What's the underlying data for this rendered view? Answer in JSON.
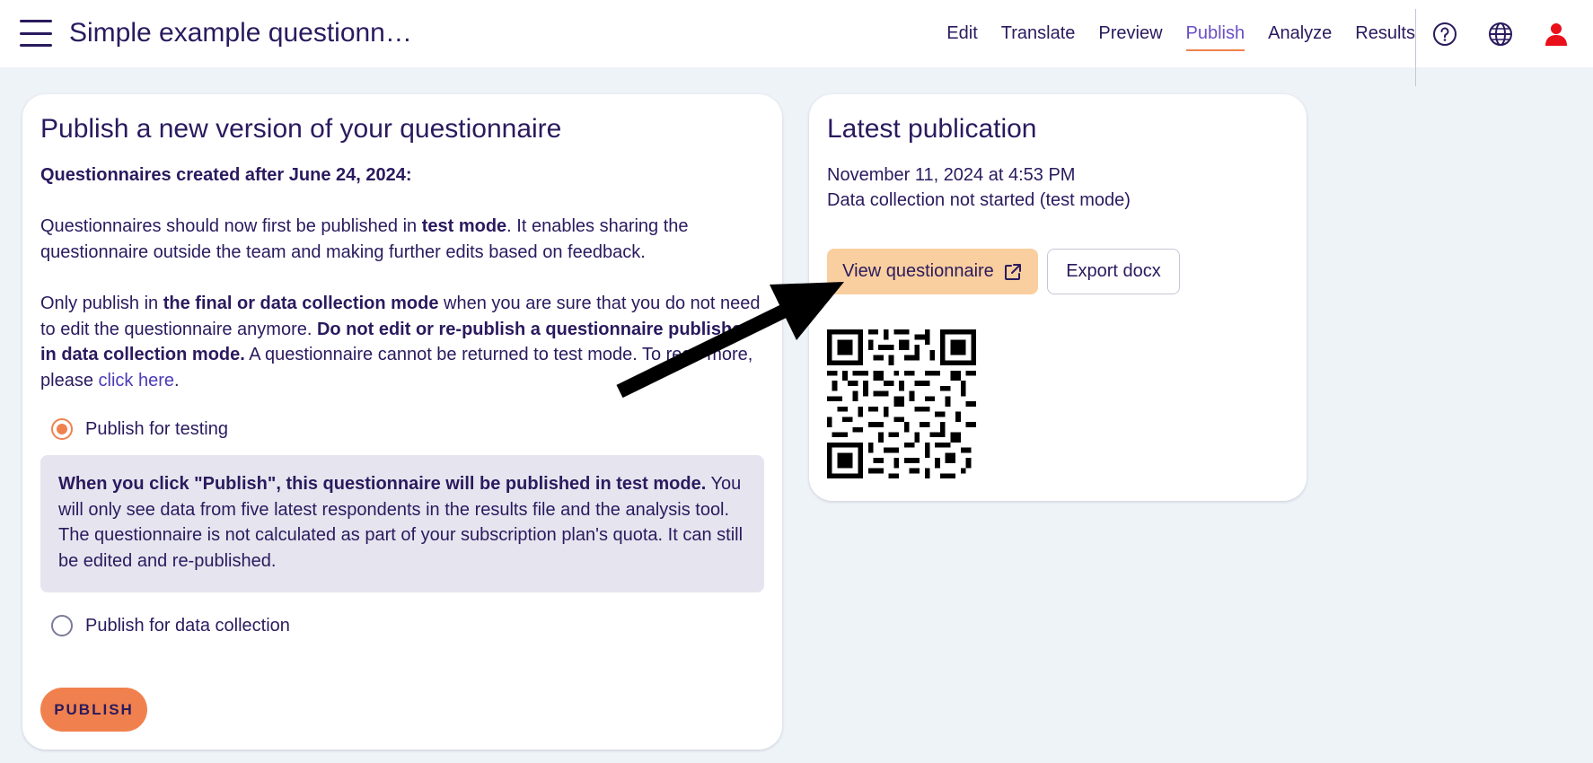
{
  "header": {
    "title": "Simple example questionn…",
    "nav": [
      {
        "label": "Edit"
      },
      {
        "label": "Translate"
      },
      {
        "label": "Preview"
      },
      {
        "label": "Publish",
        "active": true
      },
      {
        "label": "Analyze"
      },
      {
        "label": "Results"
      }
    ],
    "icons": [
      "help-icon",
      "globe-icon",
      "user-icon"
    ],
    "accent_color": "#f0814e",
    "user_icon_color": "#e8101a"
  },
  "publish_card": {
    "title": "Publish a new version of your questionnaire",
    "notice_heading": "Questionnaires created after June 24, 2024:",
    "para1_a": "Questionnaires should now first be published in ",
    "para1_b": "test mode",
    "para1_c": ". It enables sharing the questionnaire outside the team and making further edits based on feedback.",
    "para2_a": "Only publish in ",
    "para2_b": "the final or data collection mode",
    "para2_c": " when you are sure that you do not need to edit the questionnaire anymore. ",
    "para2_d": "Do not edit or re-publish a questionnaire published in data collection mode.",
    "para2_e": " A questionnaire cannot be returned to test mode. To read more, please ",
    "para2_link": "click here",
    "para2_end": ".",
    "options": {
      "testing": {
        "label": "Publish for testing",
        "selected": true
      },
      "data_collection": {
        "label": "Publish for data collection",
        "selected": false
      }
    },
    "info_bold": "When you click \"Publish\", this questionnaire will be published in test mode.",
    "info_text": " You will only see data from five latest respondents in the results file and the analysis tool. The questionnaire is not calculated as part of your subscription plan's quota. It can still be edited and re-published.",
    "publish_button": "PUBLISH"
  },
  "latest_card": {
    "title": "Latest publication",
    "date": "November 11, 2024 at 4:53 PM",
    "status": "Data collection not started (test mode)",
    "view_button": "View questionnaire",
    "export_button": "Export docx"
  }
}
